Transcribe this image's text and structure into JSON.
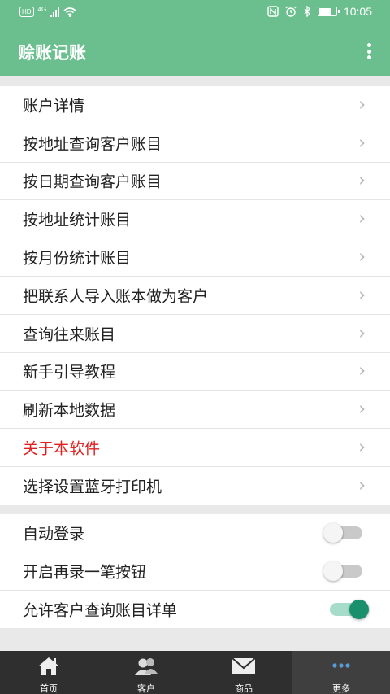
{
  "status_bar": {
    "network": "4G",
    "hd": "HD",
    "time": "10:05",
    "battery_level": 0.8
  },
  "app_bar": {
    "title": "赊账记账"
  },
  "menu_items": [
    {
      "label": "账户详情",
      "highlight": false
    },
    {
      "label": "按地址查询客户账目",
      "highlight": false
    },
    {
      "label": "按日期查询客户账目",
      "highlight": false
    },
    {
      "label": "按地址统计账目",
      "highlight": false
    },
    {
      "label": "按月份统计账目",
      "highlight": false
    },
    {
      "label": "把联系人导入账本做为客户",
      "highlight": false
    },
    {
      "label": "查询往来账目",
      "highlight": false
    },
    {
      "label": "新手引导教程",
      "highlight": false
    },
    {
      "label": "刷新本地数据",
      "highlight": false
    },
    {
      "label": "关于本软件",
      "highlight": true
    },
    {
      "label": "选择设置蓝牙打印机",
      "highlight": false
    }
  ],
  "settings": [
    {
      "label": "自动登录",
      "enabled": false
    },
    {
      "label": "开启再录一笔按钮",
      "enabled": false
    },
    {
      "label": "允许客户查询账目详单",
      "enabled": true
    }
  ],
  "tabs": [
    {
      "label": "首页",
      "icon": "home-icon",
      "active": false
    },
    {
      "label": "客户",
      "icon": "customers-icon",
      "active": false
    },
    {
      "label": "商品",
      "icon": "mail-icon",
      "active": false
    },
    {
      "label": "更多",
      "icon": "more-dots-icon",
      "active": true
    }
  ],
  "colors": {
    "primary": "#6bbf8e",
    "highlight_text": "#e02020",
    "toggle_on": "#19906b",
    "tabbar_bg": "#2f2f2f"
  }
}
